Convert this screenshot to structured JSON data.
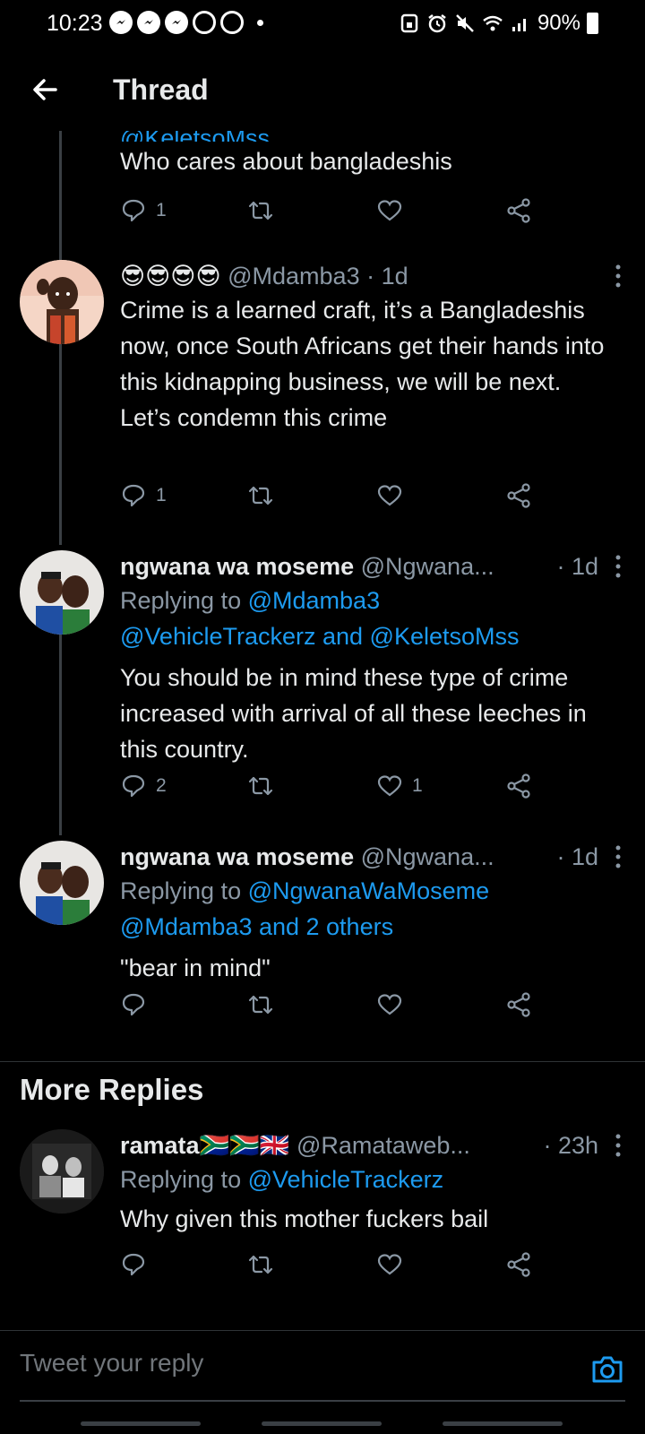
{
  "status_bar": {
    "time": "10:23",
    "battery": "90%"
  },
  "header": {
    "title": "Thread"
  },
  "partial_tweet": {
    "handle_fragment": "@KeletsoMss",
    "text": "Who cares about bangladeshis",
    "reply_count": "1",
    "retweet_count": "",
    "like_count": ""
  },
  "tweets": [
    {
      "name": "😎😎😎😎",
      "handle": "@Mdamba3",
      "time": "· 1d",
      "text": "Crime is a learned craft, it’s a Bangladeshis now, once South Africans get  their hands into this kidnapping business, we will be next. Let’s condemn this crime",
      "reply_count": "1",
      "like_count": ""
    },
    {
      "name": "ngwana wa moseme",
      "handle": "@Ngwana...",
      "time": "· 1d",
      "replying_prefix": "Replying to",
      "replying_line1": "@Mdamba3",
      "replying_line2": "@VehicleTrackerz and @KeletsoMss",
      "text": "You should be in mind these type of crime increased with arrival of all these leeches in this country.",
      "reply_count": "2",
      "like_count": "1"
    },
    {
      "name": "ngwana wa moseme",
      "handle": "@Ngwana...",
      "time": "· 1d",
      "replying_prefix": "Replying to",
      "replying_line1": "@NgwanaWaMoseme",
      "replying_line2": "@Mdamba3 and 2 others",
      "text": "\"bear in mind\"",
      "reply_count": "",
      "like_count": ""
    }
  ],
  "more_replies": {
    "heading": "More Replies",
    "tweet": {
      "name": "ramata🇿🇦🇿🇦🇬🇧",
      "handle": "@Ramataweb...",
      "time": "· 23h",
      "replying_prefix": "Replying to",
      "replying_line1": "@VehicleTrackerz",
      "text": "Why given this mother fuckers bail"
    }
  },
  "composer": {
    "placeholder": "Tweet your reply"
  },
  "colors": {
    "link": "#1d9bf0",
    "muted": "#8b98a5",
    "background": "#000000"
  }
}
